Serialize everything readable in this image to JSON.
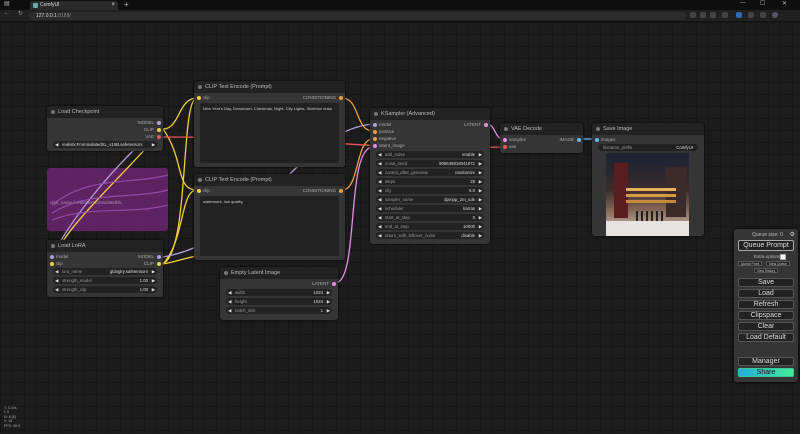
{
  "browser": {
    "tab_title": "ComfyUI",
    "tab_close": "×",
    "new_tab": "+",
    "url_host": "127.0.0.1",
    "url_path": ":8188/",
    "win_min": "—",
    "win_max": "☐",
    "win_close": "✕"
  },
  "nodes": {
    "load_checkpoint": {
      "title": "Load Checkpoint",
      "out_model": "MODEL",
      "out_clip": "CLIP",
      "out_vae": "VAE",
      "ckpt_name": "realisticFromIsolatedXL_v15B.safetensors"
    },
    "clip_pos": {
      "title": "CLIP Text Encode (Prompt)",
      "in_clip": "clip",
      "out": "CONDITIONING",
      "text": "New Year's Day, Downtown, Christmas, Night, City Lights, Skeleton draw"
    },
    "clip_neg": {
      "title": "CLIP Text Encode (Prompt)",
      "in_clip": "clip",
      "out": "CONDITIONING",
      "text": "watermark, low quality,"
    },
    "ksampler": {
      "title": "KSampler (Advanced)",
      "in_model": "model",
      "in_positive": "positive",
      "in_negative": "negative",
      "in_latent": "latent_image",
      "out": "LATENT",
      "widgets": [
        {
          "label": "add_noise",
          "value": "enable"
        },
        {
          "label": "noise_seed",
          "value": "905648818041871"
        },
        {
          "label": "control_after_generate",
          "value": "randomize"
        },
        {
          "label": "steps",
          "value": "25"
        },
        {
          "label": "cfg",
          "value": "6.0"
        },
        {
          "label": "sampler_name",
          "value": "dpmpp_2m_sde"
        },
        {
          "label": "scheduler",
          "value": "karras"
        },
        {
          "label": "start_at_step",
          "value": "0"
        },
        {
          "label": "end_at_step",
          "value": "10000"
        },
        {
          "label": "return_with_leftover_noise",
          "value": "disable"
        }
      ]
    },
    "vae_decode": {
      "title": "VAE Decode",
      "in_samples": "samples",
      "in_vae": "vae",
      "out": "IMAGE"
    },
    "save_image": {
      "title": "Save Image",
      "in_images": "images",
      "prefix_label": "filename_prefix",
      "prefix_value": "ComfyUI"
    },
    "load_lora": {
      "title": "Load LoRA",
      "in_model": "model",
      "in_clip": "clip",
      "out_model": "MODEL",
      "out_clip": "CLIP",
      "widgets": [
        {
          "label": "lora_name",
          "value": "gldnglry.safetensors"
        },
        {
          "label": "strength_model",
          "value": "1.00"
        },
        {
          "label": "strength_clip",
          "value": "1.00"
        }
      ]
    },
    "empty_latent": {
      "title": "Empty Latent Image",
      "out": "LATENT",
      "widgets": [
        {
          "label": "width",
          "value": "1024"
        },
        {
          "label": "height",
          "value": "1024"
        },
        {
          "label": "batch_size",
          "value": "1"
        }
      ]
    }
  },
  "bypass_ghost": "ckpt_name / realisticFromIsolatedXL",
  "queue_panel": {
    "queue_size": "Queue size: 0",
    "queue_prompt": "Queue Prompt",
    "extra_options": "Extra options",
    "queue_front": "Queue Front",
    "view_queue": "View Queue",
    "view_history": "View History",
    "save": "Save",
    "load": "Load",
    "refresh": "Refresh",
    "clipspace": "Clipspace",
    "clear": "Clear",
    "load_default": "Load Default",
    "manager": "Manager",
    "share": "Share"
  },
  "stats": [
    "T: 0.00s",
    "I: 0",
    "N: 8 [8]",
    "V: 16",
    "FPS: 59.9"
  ],
  "colors": {
    "clip": "#f5d03a",
    "model": "#b39ddb",
    "latent": "#e78de7",
    "vae": "#e55",
    "conditioning": "#f0a040",
    "image": "#64b5f6"
  }
}
